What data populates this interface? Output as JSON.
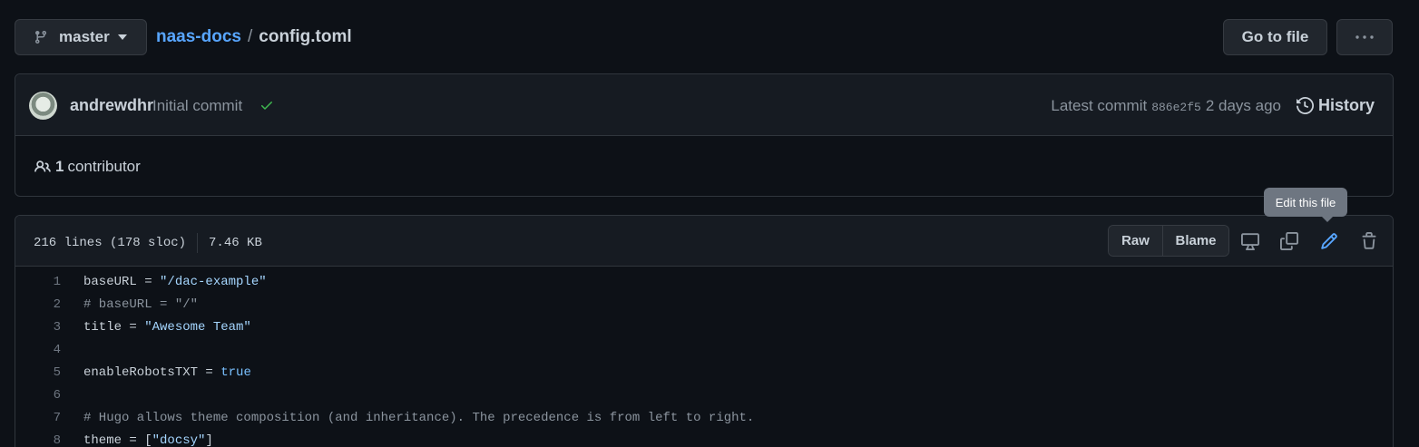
{
  "branch": {
    "name": "master",
    "icon": "git-branch-icon"
  },
  "breadcrumb": {
    "repo": "naas-docs",
    "separator": "/",
    "file": "config.toml"
  },
  "actions": {
    "goto_file": "Go to file",
    "more_icon": "kebab-horizontal-icon"
  },
  "commit": {
    "author": "andrewdhr",
    "message": "Initial commit",
    "status_icon": "check-icon",
    "latest_label": "Latest commit",
    "sha": "886e2f5",
    "time": "2 days ago",
    "history_label": "History"
  },
  "contributors": {
    "count": "1",
    "label": "contributor",
    "icon": "people-icon"
  },
  "file": {
    "lines_info": "216 lines (178 sloc)",
    "size": "7.46 KB",
    "raw_label": "Raw",
    "blame_label": "Blame",
    "tooltip": "Edit this file"
  },
  "code_lines": [
    {
      "n": "1",
      "parts": [
        [
          "plain",
          "baseURL = "
        ],
        [
          "str",
          "\"/dac-example\""
        ]
      ]
    },
    {
      "n": "2",
      "parts": [
        [
          "com",
          "# baseURL = \"/\""
        ]
      ]
    },
    {
      "n": "3",
      "parts": [
        [
          "plain",
          "title = "
        ],
        [
          "str",
          "\"Awesome Team\""
        ]
      ]
    },
    {
      "n": "4",
      "parts": []
    },
    {
      "n": "5",
      "parts": [
        [
          "plain",
          "enableRobotsTXT = "
        ],
        [
          "kw",
          "true"
        ]
      ]
    },
    {
      "n": "6",
      "parts": []
    },
    {
      "n": "7",
      "parts": [
        [
          "com",
          "# Hugo allows theme composition (and inheritance). The precedence is from left to right."
        ]
      ]
    },
    {
      "n": "8",
      "parts": [
        [
          "plain",
          "theme = ["
        ],
        [
          "str",
          "\"docsy\""
        ],
        [
          "plain",
          "]"
        ]
      ]
    }
  ],
  "colors": {
    "link": "#58a6ff",
    "success": "#3fb950",
    "accent_edit": "#58a6ff"
  }
}
